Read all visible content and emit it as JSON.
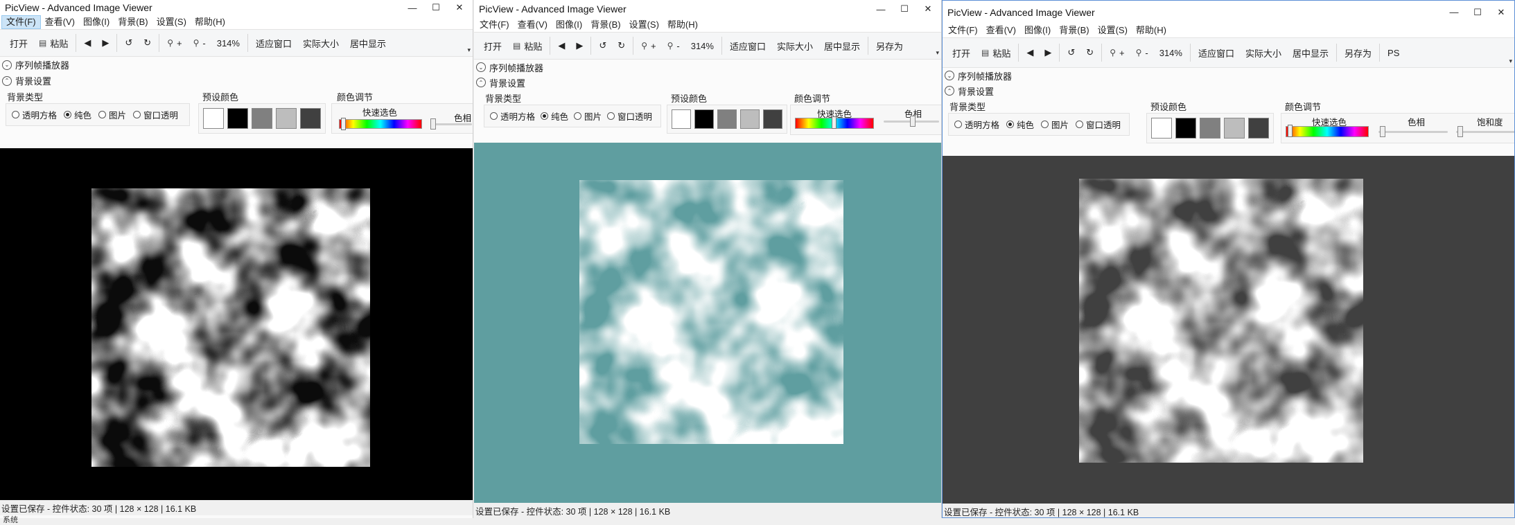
{
  "app": {
    "title": "PicView - Advanced Image Viewer",
    "window_controls": [
      "—",
      "☐",
      "✕"
    ]
  },
  "menu": [
    "文件(F)",
    "查看(V)",
    "图像(I)",
    "背景(B)",
    "设置(S)",
    "帮助(H)"
  ],
  "toolbar": {
    "open": "打开",
    "paste": "粘贴",
    "prev": "◀",
    "next": "▶",
    "rotate_left": "↺",
    "rotate_right": "↻",
    "zoom_in": "+",
    "zoom_out": "-",
    "zoom": "314%",
    "fit": "适应窗口",
    "actual": "实际大小",
    "center": "居中显示",
    "save_as": "另存为",
    "ps": "PS",
    "overflow": "▾"
  },
  "sections": {
    "sequence": "序列帧播放器",
    "background": "背景设置"
  },
  "background": {
    "type_label": "背景类型",
    "types": [
      "透明方格",
      "纯色",
      "图片",
      "窗口透明"
    ],
    "selected_type": "纯色",
    "preset_label": "预设颜色",
    "presets": [
      "#ffffff",
      "#000000",
      "#808080",
      "#bdbdbd",
      "#404040"
    ],
    "adjust_label": "颜色调节",
    "quick_pick": "快速选色",
    "hue": "色相",
    "saturation": "饱和度"
  },
  "windows": [
    {
      "bg_color": "#000000"
    },
    {
      "bg_color": "#5f9ea0"
    },
    {
      "bg_color": "#404040"
    }
  ],
  "status": "设置已保存 - 控件状态: 30 项 | 128 × 128 | 16.1 KB",
  "below_text": "系统"
}
